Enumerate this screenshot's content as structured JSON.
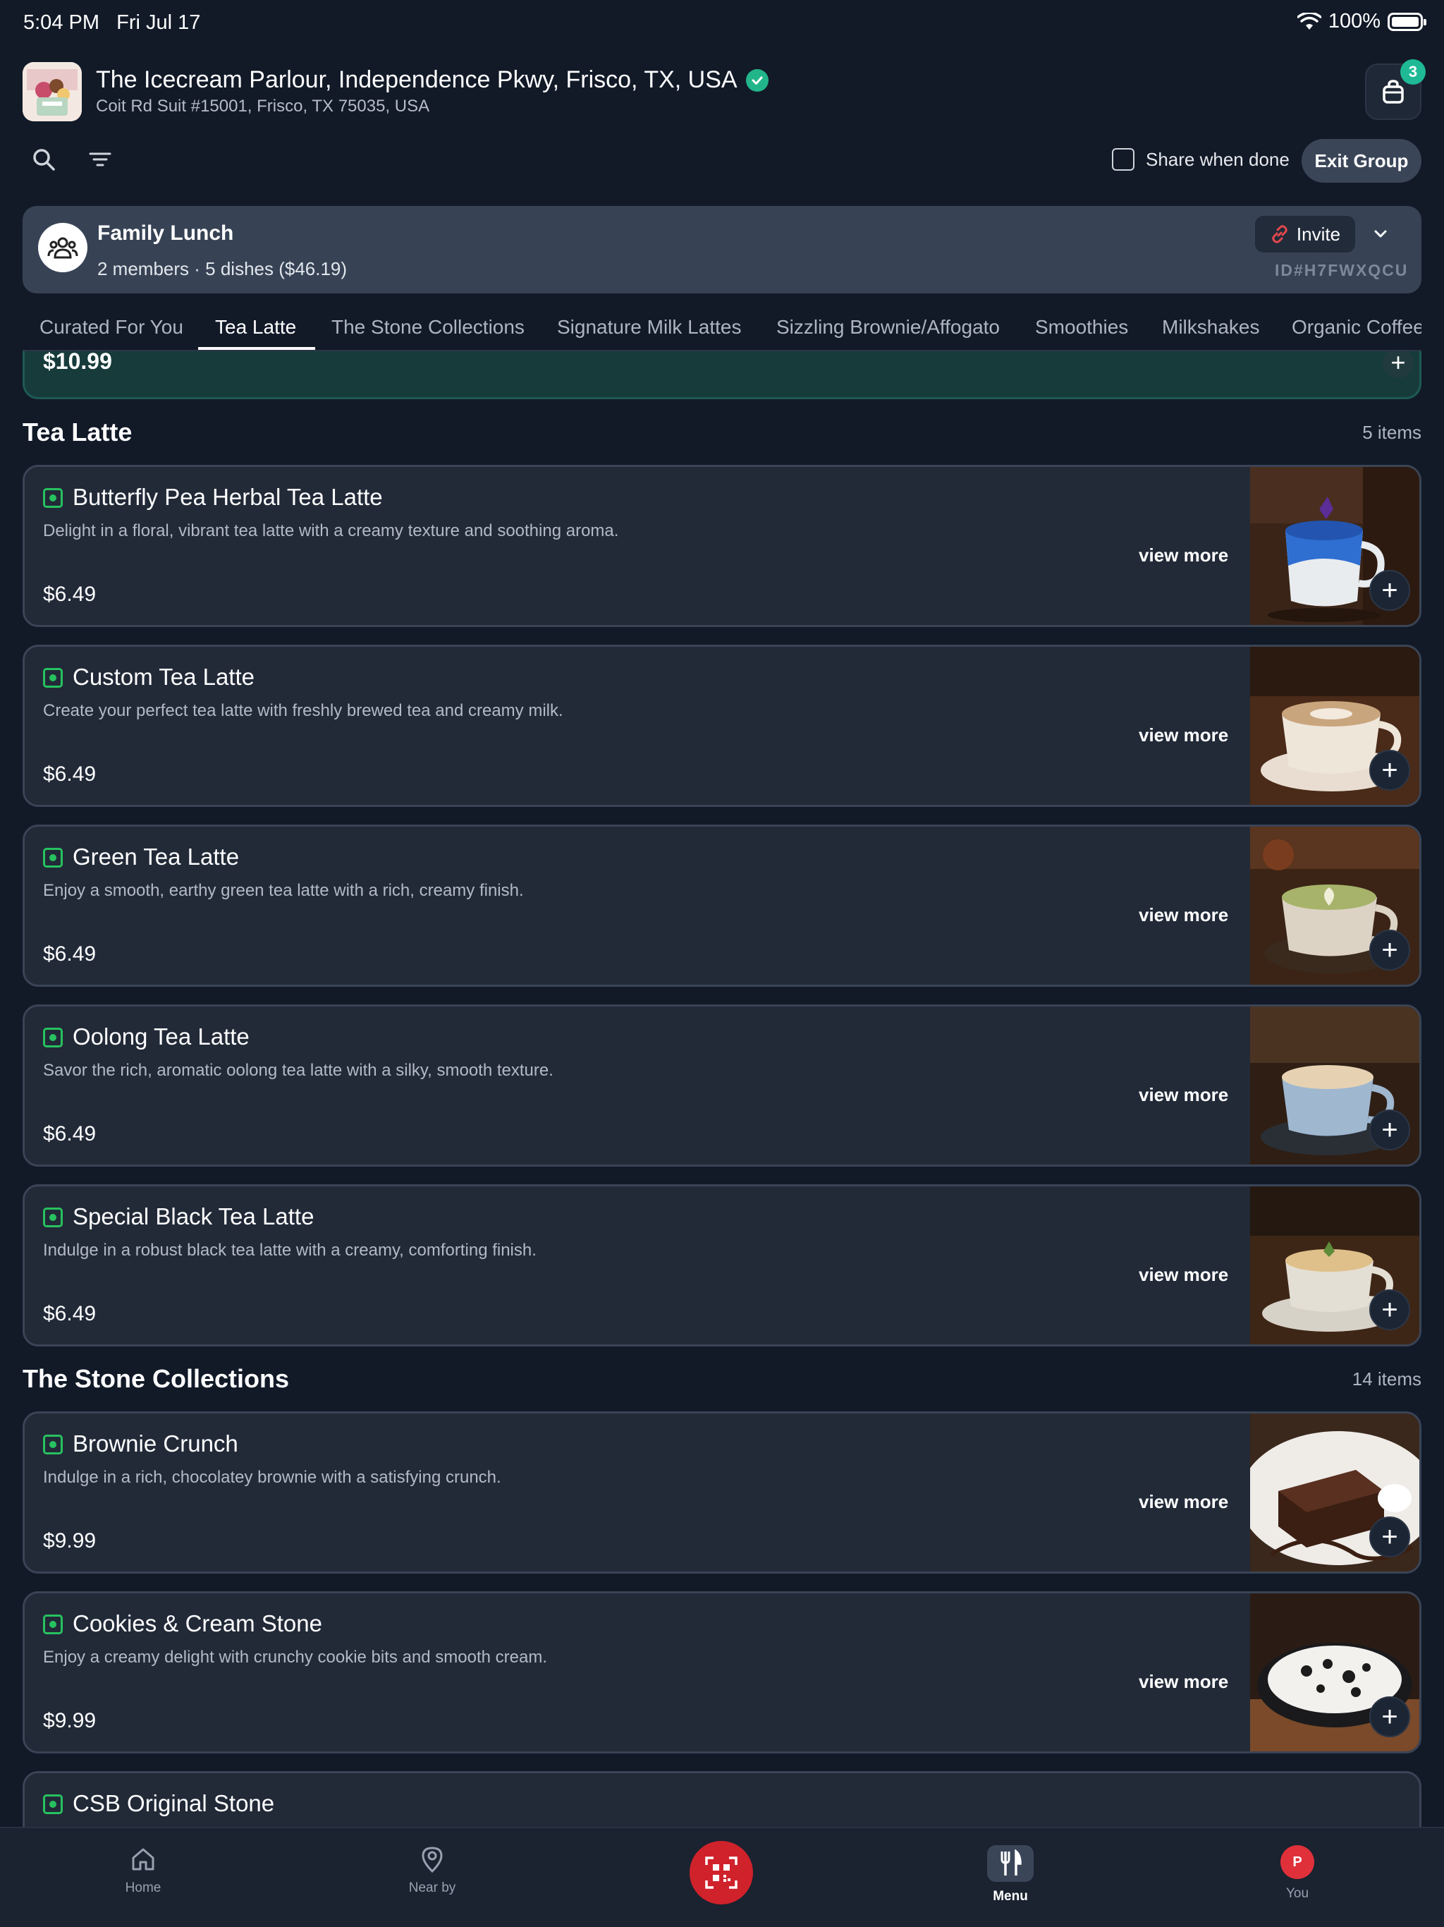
{
  "status": {
    "time": "5:04 PM",
    "date": "Fri Jul 17",
    "battery": "100%"
  },
  "header": {
    "title": "The Icecream Parlour, Independence Pkwy, Frisco, TX, USA",
    "address": "Coit Rd Suit #15001, Frisco, TX 75035, USA",
    "cart_count": "3"
  },
  "toolbar": {
    "share_label": "Share when done",
    "exit_label": "Exit Group"
  },
  "group": {
    "name": "Family Lunch",
    "meta": "2 members · 5 dishes ($46.19)",
    "invite_label": "Invite",
    "id": "ID#H7FWXQCU"
  },
  "tabs": [
    {
      "label": "Curated For You"
    },
    {
      "label": "Tea Latte"
    },
    {
      "label": "The Stone Collections"
    },
    {
      "label": "Signature Milk Lattes"
    },
    {
      "label": "Sizzling Brownie/Affogato"
    },
    {
      "label": "Smoothies"
    },
    {
      "label": "Milkshakes"
    },
    {
      "label": "Organic Coffee"
    }
  ],
  "active_tab": "Tea Latte",
  "prev_card": {
    "price": "$10.99"
  },
  "sections": [
    {
      "title": "Tea Latte",
      "count": "5 items",
      "items": [
        {
          "name": "Butterfly Pea Herbal Tea Latte",
          "desc": "Delight in a floral, vibrant tea latte with a creamy texture and soothing aroma.",
          "price": "$6.49",
          "more": "view more",
          "image": "blue-tea-latte-cup"
        },
        {
          "name": "Custom Tea Latte",
          "desc": "Create your perfect tea latte with freshly brewed tea and creamy milk.",
          "price": "$6.49",
          "more": "view more",
          "image": "latte-art-cup"
        },
        {
          "name": "Green Tea Latte",
          "desc": "Enjoy a smooth, earthy green tea latte with a rich, creamy finish.",
          "price": "$6.49",
          "more": "view more",
          "image": "matcha-latte-cup"
        },
        {
          "name": "Oolong Tea Latte",
          "desc": "Savor the rich, aromatic oolong tea latte with a silky, smooth texture.",
          "price": "$6.49",
          "more": "view more",
          "image": "milk-tea-blue-cup"
        },
        {
          "name": "Special Black Tea Latte",
          "desc": "Indulge in a robust black tea latte with a creamy, comforting finish.",
          "price": "$6.49",
          "more": "view more",
          "image": "black-tea-latte-cup"
        }
      ]
    },
    {
      "title": "The Stone Collections",
      "count": "14 items",
      "items": [
        {
          "name": "Brownie Crunch",
          "desc": "Indulge in a rich, chocolatey brownie with a satisfying crunch.",
          "price": "$9.99",
          "more": "view more",
          "image": "brownie-plate"
        },
        {
          "name": "Cookies & Cream Stone",
          "desc": "Enjoy a creamy delight with crunchy cookie bits and smooth cream.",
          "price": "$9.99",
          "more": "view more",
          "image": "cookies-cream-skillet"
        },
        {
          "name": "CSB Original Stone",
          "desc": "",
          "price": "",
          "more": "",
          "image": ""
        }
      ]
    }
  ],
  "nav": [
    {
      "label": "Home",
      "icon": "home-icon"
    },
    {
      "label": "Near by",
      "icon": "map-pin-icon"
    },
    {
      "label": "",
      "icon": "qr-scan-icon"
    },
    {
      "label": "Menu",
      "icon": "fork-knife-icon"
    },
    {
      "label": "You",
      "icon": "avatar",
      "initial": "P"
    }
  ],
  "colors": {
    "accent_green": "#27c25f",
    "badge_teal": "#1fb996",
    "qr_red": "#d0222b",
    "background": "#121a28"
  }
}
